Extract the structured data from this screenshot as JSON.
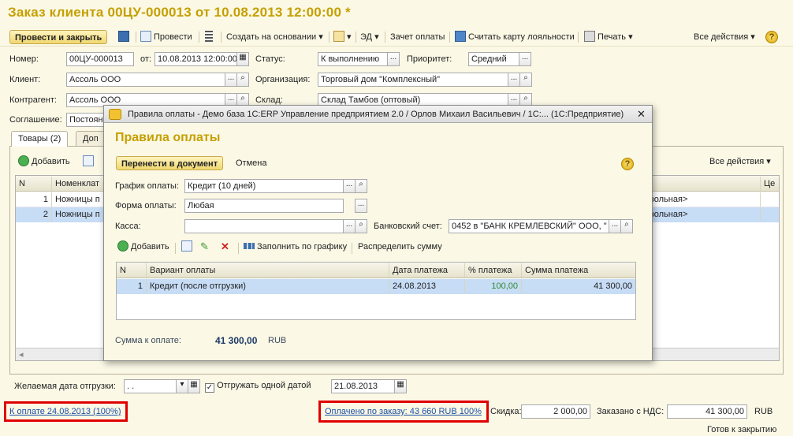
{
  "window_title": "Заказ клиента 00ЦУ-000013 от 10.08.2013 12:00:00 *",
  "toolbar": {
    "post_close": "Провести и закрыть",
    "post": "Провести",
    "create_based": "Создать на основании",
    "ed": "ЭД",
    "invoice": "Зачет оплаты",
    "loyalty": "Считать карту лояльности",
    "print": "Печать",
    "all_actions": "Все действия"
  },
  "form": {
    "number_label": "Номер:",
    "number": "00ЦУ-000013",
    "from_label": "от:",
    "date": "10.08.2013 12:00:00",
    "status_label": "Статус:",
    "status": "К выполнению",
    "priority_label": "Приоритет:",
    "priority": "Средний",
    "client_label": "Клиент:",
    "client": "Ассоль ООО",
    "org_label": "Организация:",
    "org": "Торговый дом \"Комплексный\"",
    "contractor_label": "Контрагент:",
    "contractor": "Ассоль ООО",
    "warehouse_label": "Склад:",
    "warehouse": "Склад Тамбов (оптовый)",
    "agreement_label": "Соглашение:",
    "agreement": "Постоян"
  },
  "tabs": [
    "Товары (2)",
    "Доп"
  ],
  "goods": {
    "add": "Добавить",
    "all_actions": "Все действия",
    "columns": [
      "N",
      "Номенклат",
      "",
      "Це"
    ],
    "rows": [
      {
        "n": "1",
        "name": "Ножницы п",
        "tail": "звольная>"
      },
      {
        "n": "2",
        "name": "Ножницы п",
        "tail": "звольная>"
      }
    ],
    "desired_date_label": "Желаемая дата отгрузки:",
    "desired_date": ". .",
    "ship_one_date": "Отгружать одной датой",
    "ship_date": "21.08.2013"
  },
  "footer": {
    "pay_link": "К оплате 24.08.2013 (100%)",
    "paid_link": "Оплачено по заказу: 43 660 RUB  100%",
    "discount_label": "Скидка:",
    "discount": "2 000,00",
    "ordered_label": "Заказано с НДС:",
    "ordered": "41 300,00",
    "currency": "RUB",
    "ready_close": "Готов к закрытию"
  },
  "dialog": {
    "title": "Правила оплаты - Демо база 1С:ERP Управление предприятием 2.0 / Орлов Михаил Васильевич / 1С:...  (1С:Предприятие)",
    "heading": "Правила оплаты",
    "transfer": "Перенести в документ",
    "cancel": "Отмена",
    "schedule_label": "График оплаты:",
    "schedule": "Кредит (10 дней)",
    "form_label": "Форма оплаты:",
    "form": "Любая",
    "cash_label": "Касса:",
    "cash": "",
    "bank_label": "Банковский счет:",
    "bank": "0452 в \"БАНК КРЕМЛЕВСКИЙ\" ООО, \"",
    "add": "Добавить",
    "fill_schedule": "Заполнить по графику",
    "distribute": "Распределить сумму",
    "columns": [
      "N",
      "Вариант оплаты",
      "Дата платежа",
      "% платежа",
      "Сумма платежа"
    ],
    "rows": [
      {
        "n": "1",
        "variant": "Кредит (после отгрузки)",
        "date": "24.08.2013",
        "pct": "100,00",
        "sum": "41 300,00"
      }
    ],
    "total_label": "Сумма к оплате:",
    "total": "41 300,00",
    "currency": "RUB"
  }
}
